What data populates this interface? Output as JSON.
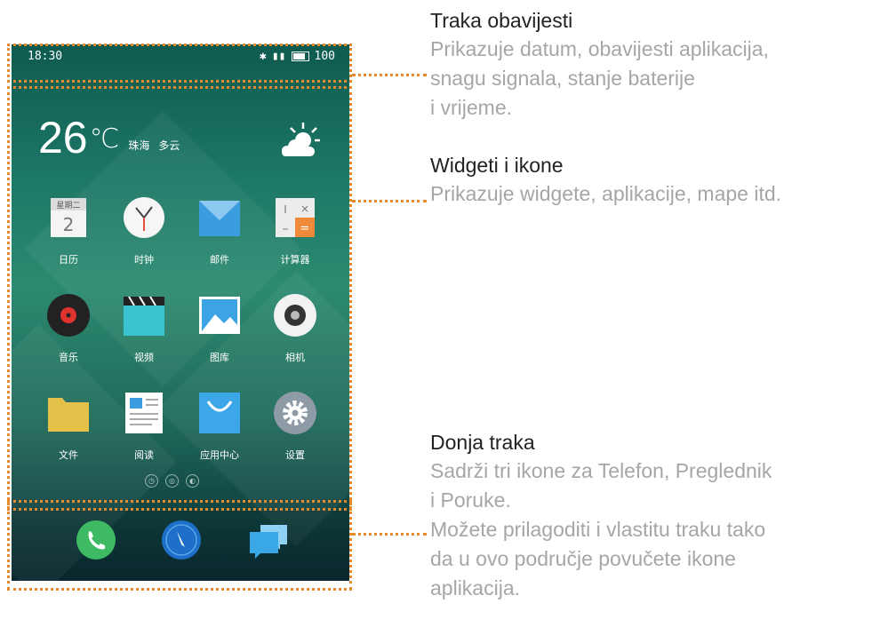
{
  "phone": {
    "status_time": "18:30",
    "status_battery": "100",
    "weather": {
      "temp": "26",
      "unit": "℃",
      "city": "珠海",
      "condition": "多云"
    },
    "apps": [
      {
        "label": "日历",
        "icon": "calendar-icon",
        "color": "#e9e9e9"
      },
      {
        "label": "时钟",
        "icon": "clock-icon",
        "color": "#f5f5f5"
      },
      {
        "label": "邮件",
        "icon": "mail-icon",
        "color": "#3b9ce0"
      },
      {
        "label": "计算器",
        "icon": "calculator-icon",
        "color": "#ececec"
      },
      {
        "label": "音乐",
        "icon": "music-icon",
        "color": "#222222"
      },
      {
        "label": "视频",
        "icon": "video-icon",
        "color": "#39c4d0"
      },
      {
        "label": "图库",
        "icon": "gallery-icon",
        "color": "#3ca3e5"
      },
      {
        "label": "相机",
        "icon": "camera-icon",
        "color": "#f2f2f2"
      },
      {
        "label": "文件",
        "icon": "folder-icon",
        "color": "#e6c14a"
      },
      {
        "label": "阅读",
        "icon": "reader-icon",
        "color": "#ffffff"
      },
      {
        "label": "应用中心",
        "icon": "app-store-icon",
        "color": "#3ba7e8"
      },
      {
        "label": "设置",
        "icon": "settings-icon",
        "color": "#8e9aa6"
      }
    ],
    "page_dots": [
      "◷",
      "◎",
      "◐"
    ],
    "dock": [
      {
        "name": "phone",
        "icon": "phone-icon",
        "color": "#3dba62"
      },
      {
        "name": "browser",
        "icon": "compass-icon",
        "color": "#1e6fc9"
      },
      {
        "name": "messages",
        "icon": "messages-icon",
        "color": "#3aa8e6"
      }
    ]
  },
  "annotations": {
    "status_bar": {
      "title": "Traka obavijesti",
      "lines": [
        "Prikazuje datum, obavijesti aplikacija,",
        "snagu signala, stanje baterije",
        "i vrijeme."
      ]
    },
    "widgets": {
      "title": "Widgeti i ikone",
      "lines": [
        "Prikazuje widgete, aplikacije, mape itd."
      ]
    },
    "dock": {
      "title": "Donja traka",
      "lines": [
        "Sadrži tri ikone za Telefon, Preglednik",
        "i Poruke.",
        "Možete prilagoditi i vlastitu traku tako",
        "da u ovo područje povučete ikone",
        "aplikacija."
      ]
    }
  },
  "accent_color": "#e88a2a"
}
